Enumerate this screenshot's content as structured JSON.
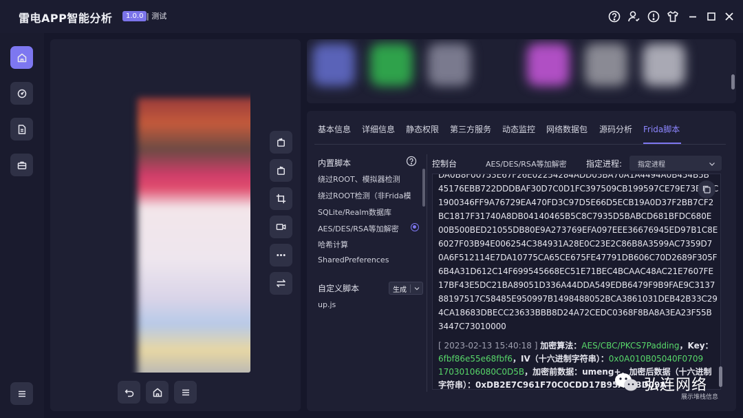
{
  "app": {
    "title": "雷电APP智能分析",
    "version": "1.0.0",
    "env": "| 测试"
  },
  "titlebar_icons": [
    "help-icon",
    "user-icon",
    "info-icon",
    "shirt-icon",
    "minimize-icon",
    "maximize-icon",
    "close-icon"
  ],
  "sidebar": {
    "items": [
      {
        "icon": "home-icon",
        "active": true
      },
      {
        "icon": "gauge-icon",
        "active": false
      },
      {
        "icon": "document-icon",
        "active": false
      },
      {
        "icon": "toolbox-icon",
        "active": false
      }
    ],
    "menu_icon": "menu-icon"
  },
  "device_tools": [
    "rotate-left-icon",
    "rotate-right-icon",
    "crop-icon",
    "video-icon",
    "more-icon",
    "switch-icon"
  ],
  "device_nav": [
    "back-icon",
    "home-icon",
    "menu-icon"
  ],
  "tabs": [
    {
      "label": "基本信息"
    },
    {
      "label": "详细信息"
    },
    {
      "label": "静态权限"
    },
    {
      "label": "第三方服务"
    },
    {
      "label": "动态监控"
    },
    {
      "label": "网络数据包"
    },
    {
      "label": "源码分析"
    },
    {
      "label": "Frida脚本",
      "active": true
    }
  ],
  "builtin_scripts": {
    "title": "内置脚本",
    "items": [
      {
        "label": "绕过ROOT、模拟器检测"
      },
      {
        "label": "绕过ROOT检测（非Frida模"
      },
      {
        "label": "SQLite/Realm数据库"
      },
      {
        "label": "AES/DES/RSA等加解密",
        "selected": true
      },
      {
        "label": "哈希计算"
      },
      {
        "label": "SharedPreferences"
      }
    ]
  },
  "custom_scripts": {
    "title": "自定义脚本",
    "generate_label": "生成",
    "files": [
      "up.js"
    ]
  },
  "console": {
    "title": "控制台",
    "script_name": "AES/DES/RSA等加解密",
    "process_label": "指定进程:",
    "process_value": "指定进程",
    "hex_lines": [
      "DA0B8F00753E67F26E02254284ADD05BA70A1A4494A0B454B5B",
      "45176EBB722DDDBAF30D7C0D1FC397509CB199597CE79E73B9DC",
      "1900346FF9A76729EA470FD3C97D5E66D5ECB19A0D37F2BB7CF2",
      "BC1817F31740A8DB04140465B5C8C7935D5BABCD681BFDC680E",
      "00B500BED21055DB80E9A273769EFA097EEE36676945ED97B1C8E",
      "6027F03B94E006254C384931A28E0C23E2C86B8A3599AC7359D7",
      "0A6F512114E7DA10775CA65CE675FE47791DB606C70D2689F305F",
      "6B4A31D612C14F699545668EC51E71BEC4BCAAC48AC21E7607FE",
      "17BF43E5DC21BA89051D336A44DDA549EDB6479F9B9FAE9C3137",
      "88197517C58485E950997B1498488052BCA3861031DEB42B33C29",
      "4CA18683DBECC23633BBB8D24A72CEDC0368F8BA8A3EA23F55B",
      "3447C73010000"
    ],
    "log": {
      "timestamp": "[ 2023-02-13 15:40:18 ]",
      "algo_label": "加密算法：",
      "algo": "AES/CBC/PKCS7Padding",
      "key_label": "，Key：",
      "key_part1": "6fbf86e55e68fbf6",
      "iv_label": "，IV（十六进制字符串）：",
      "iv_part1": "0x0A010B05040F0709",
      "iv_part2": "17030106080C0D5B",
      "plain_label": "，加密前数据：",
      "plain": "umeng+",
      "cipher_label": "，加密后数据（十六进制",
      "cipher_label2": "字符串）：",
      "cipher": "0xDB2E7C961F70C0CDD17B95A253D09A"
    }
  },
  "watermark": {
    "name": "弘连网络",
    "sub": "展示堆栈信息"
  },
  "colors": {
    "accent": "#7d77f0",
    "green": "#58d86a",
    "bg": "#16172a",
    "panel": "#1e1f33"
  }
}
